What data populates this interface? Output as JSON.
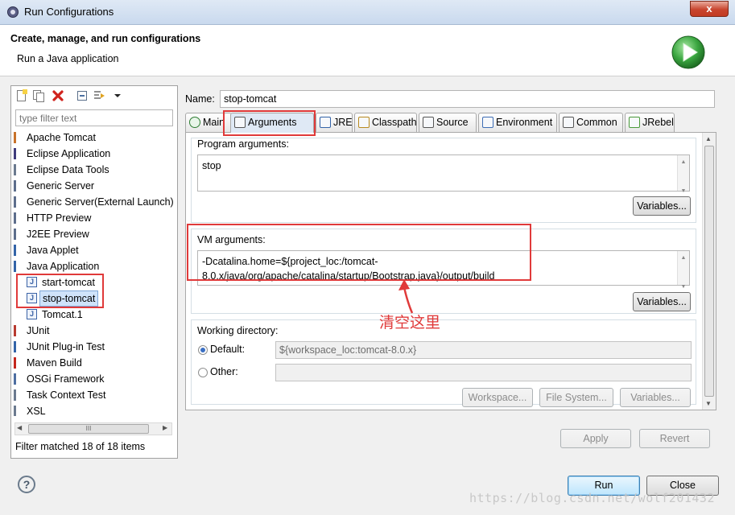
{
  "window": {
    "title": "Run Configurations",
    "close_glyph": "x"
  },
  "header": {
    "title": "Create, manage, and run configurations",
    "subtitle": "Run a Java application",
    "icon": "run-icon",
    "accent_color": "#2a9d3a"
  },
  "left": {
    "filter_placeholder": "type filter text",
    "tree": [
      {
        "label": "Apache Tomcat",
        "icon": "tomcat-icon",
        "indent": 0,
        "selected": false
      },
      {
        "label": "Eclipse Application",
        "icon": "eclipse-icon",
        "indent": 0,
        "selected": false
      },
      {
        "label": "Eclipse Data Tools",
        "icon": "datatools-icon",
        "indent": 0,
        "selected": false
      },
      {
        "label": "Generic Server",
        "icon": "server-icon",
        "indent": 0,
        "selected": false
      },
      {
        "label": "Generic Server(External Launch)",
        "icon": "server-icon",
        "indent": 0,
        "selected": false
      },
      {
        "label": "HTTP Preview",
        "icon": "server-icon",
        "indent": 0,
        "selected": false
      },
      {
        "label": "J2EE Preview",
        "icon": "server-icon",
        "indent": 0,
        "selected": false
      },
      {
        "label": "Java Applet",
        "icon": "applet-icon",
        "indent": 0,
        "selected": false
      },
      {
        "label": "Java Application",
        "icon": "java-app-icon",
        "indent": 0,
        "selected": false
      },
      {
        "label": "start-tomcat",
        "icon": "java-file-icon",
        "indent": 1,
        "selected": false
      },
      {
        "label": "stop-tomcat",
        "icon": "java-file-icon",
        "indent": 1,
        "selected": true
      },
      {
        "label": "Tomcat.1",
        "icon": "java-file-icon",
        "indent": 1,
        "selected": false
      },
      {
        "label": "JUnit",
        "icon": "junit-icon",
        "indent": 0,
        "selected": false
      },
      {
        "label": "JUnit Plug-in Test",
        "icon": "junit-plugin-icon",
        "indent": 0,
        "selected": false
      },
      {
        "label": "Maven Build",
        "icon": "maven-icon",
        "indent": 0,
        "selected": false
      },
      {
        "label": "OSGi Framework",
        "icon": "osgi-icon",
        "indent": 0,
        "selected": false
      },
      {
        "label": "Task Context Test",
        "icon": "task-icon",
        "indent": 0,
        "selected": false
      },
      {
        "label": "XSL",
        "icon": "xsl-icon",
        "indent": 0,
        "selected": false
      }
    ],
    "scroll_grip": "III",
    "status": "Filter matched 18 of 18 items"
  },
  "right": {
    "name_label": "Name:",
    "name_value": "stop-tomcat",
    "tabs": [
      {
        "label": "Main",
        "icon": "main-tab-icon",
        "active": false
      },
      {
        "label": "Arguments",
        "icon": "arguments-tab-icon",
        "active": true
      },
      {
        "label": "JRE",
        "icon": "jre-tab-icon",
        "active": false
      },
      {
        "label": "Classpath",
        "icon": "classpath-tab-icon",
        "active": false
      },
      {
        "label": "Source",
        "icon": "source-tab-icon",
        "active": false
      },
      {
        "label": "Environment",
        "icon": "environment-tab-icon",
        "active": false
      },
      {
        "label": "Common",
        "icon": "common-tab-icon",
        "active": false
      },
      {
        "label": "JRebel",
        "icon": "jrebel-tab-icon",
        "active": false
      }
    ],
    "program_args": {
      "label": "Program arguments:",
      "value": "stop",
      "variables_btn": "Variables..."
    },
    "vm_args": {
      "label": "VM arguments:",
      "line1": "-Dcatalina.home=${project_loc:/tomcat-",
      "line2": "8.0.x/java/org/apache/catalina/startup/Bootstrap.java}/output/build",
      "variables_btn": "Variables..."
    },
    "working_dir": {
      "label": "Working directory:",
      "default_label": "Default:",
      "default_value": "${workspace_loc:tomcat-8.0.x}",
      "default_checked": true,
      "other_label": "Other:",
      "other_value": "",
      "workspace_btn": "Workspace...",
      "filesystem_btn": "File System...",
      "variables_btn": "Variables..."
    },
    "apply_btn": "Apply",
    "revert_btn": "Revert"
  },
  "annotation": {
    "text": "清空这里",
    "color": "#e03a3a"
  },
  "footer": {
    "help_glyph": "?",
    "run_btn": "Run",
    "close_btn": "Close",
    "watermark": "https://blog.csdn.net/wolf201432"
  }
}
